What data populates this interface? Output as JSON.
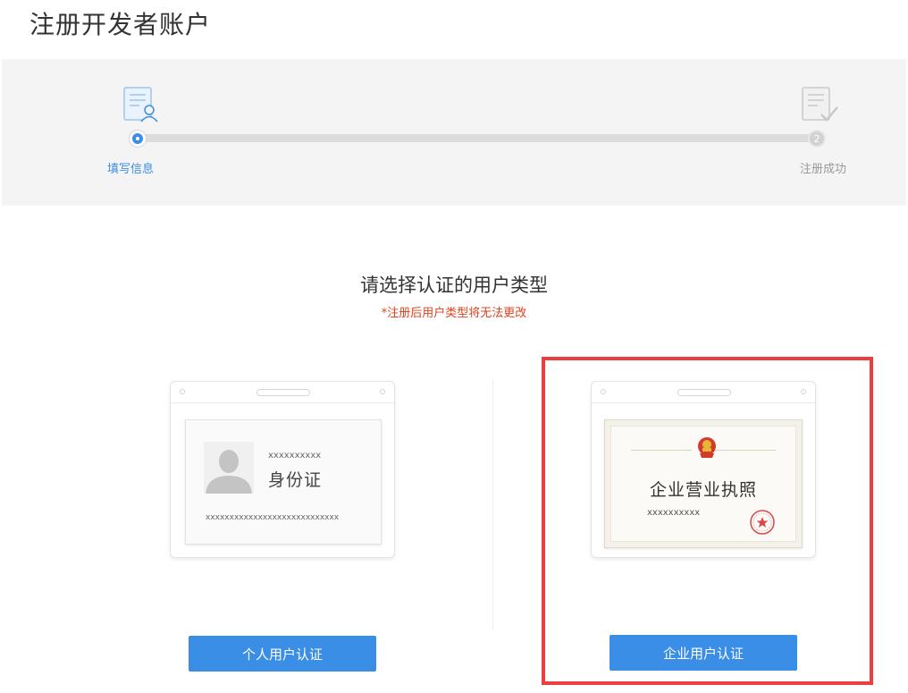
{
  "page": {
    "title": "注册开发者账户"
  },
  "steps": [
    {
      "label": "填写信息",
      "state": "active"
    },
    {
      "label": "注册成功",
      "number": "2",
      "state": "pending"
    }
  ],
  "selection": {
    "title": "请选择认证的用户类型",
    "note": "*注册后用户类型将无法更改"
  },
  "personal": {
    "card_small_text": "xxxxxxxxxx",
    "card_title": "身份证",
    "card_bottom_text": "xxxxxxxxxxxxxxxxxxxxxxxxxxxx",
    "button_label": "个人用户认证"
  },
  "business": {
    "card_title": "企业营业执照",
    "card_small_text": "xxxxxxxxxx",
    "button_label": "企业用户认证",
    "selected": true
  },
  "colors": {
    "accent": "#3a8ee6",
    "warning": "#e0401c",
    "highlight": "#ec3e3e"
  },
  "icons": [
    "form-user-icon",
    "form-check-icon",
    "avatar-silhouette-icon",
    "national-emblem-icon",
    "official-seal-icon"
  ]
}
